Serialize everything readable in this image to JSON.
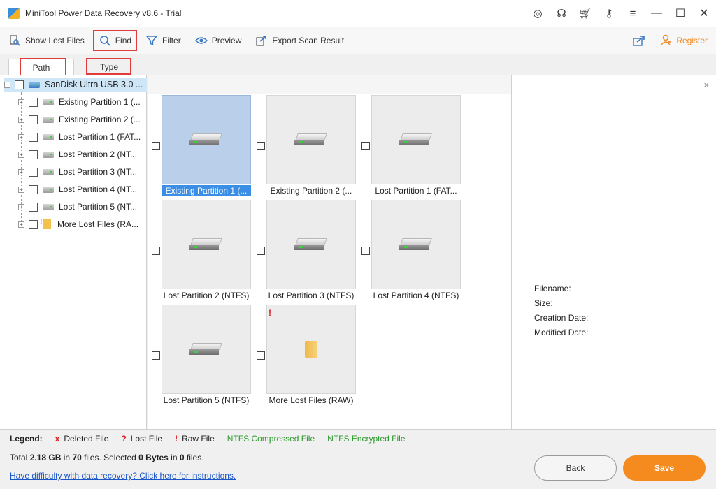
{
  "window": {
    "title": "MiniTool Power Data Recovery v8.6 - Trial",
    "icons": [
      "disc-icon",
      "support-icon",
      "cart-icon",
      "key-icon",
      "menu-icon"
    ],
    "controls": [
      "minimize-icon",
      "maximize-icon",
      "close-icon"
    ]
  },
  "toolbar": {
    "show_lost_files": "Show Lost Files",
    "find": "Find",
    "filter": "Filter",
    "preview": "Preview",
    "export": "Export Scan Result",
    "register": "Register"
  },
  "tabs": {
    "path": "Path",
    "type": "Type"
  },
  "tree": {
    "root": "SanDisk Ultra USB 3.0 ...",
    "items": [
      "Existing Partition 1 (...",
      "Existing Partition 2 (...",
      "Lost Partition 1 (FAT...",
      "Lost Partition 2 (NT...",
      "Lost Partition 3 (NT...",
      "Lost Partition 4 (NT...",
      "Lost Partition 5 (NT...",
      "More Lost Files (RA..."
    ]
  },
  "grid": {
    "tiles": [
      "Existing Partition 1 (...",
      "Existing Partition 2 (...",
      "Lost Partition 1 (FAT...",
      "Lost Partition 2 (NTFS)",
      "Lost Partition 3 (NTFS)",
      "Lost Partition 4 (NTFS)",
      "Lost Partition 5 (NTFS)",
      "More Lost Files (RAW)"
    ],
    "warning_mark": "!"
  },
  "preview_panel": {
    "close": "×",
    "filename_label": "Filename:",
    "size_label": "Size:",
    "creation_label": "Creation Date:",
    "modified_label": "Modified Date:"
  },
  "legend": {
    "label": "Legend:",
    "deleted_mark": "x",
    "deleted": "Deleted File",
    "lost_mark": "?",
    "lost": "Lost File",
    "raw_mark": "!",
    "raw": "Raw File",
    "ntfs_compressed": "NTFS Compressed File",
    "ntfs_encrypted": "NTFS Encrypted File"
  },
  "summary": {
    "total_prefix": "Total ",
    "total_size": "2.18 GB",
    "in": " in ",
    "file_count": "70",
    "files_selected": " files.  Selected ",
    "selected_size": "0 Bytes",
    "in2": " in ",
    "selected_count": "0",
    "files_end": " files."
  },
  "help_link": "Have difficulty with data recovery? Click here for instructions.",
  "buttons": {
    "back": "Back",
    "save": "Save"
  },
  "colors": {
    "accent": "#f58a1f",
    "selection": "#3a8ee6",
    "highlight_box": "#e23b3b",
    "ntfs_green": "#2a9a2a"
  }
}
